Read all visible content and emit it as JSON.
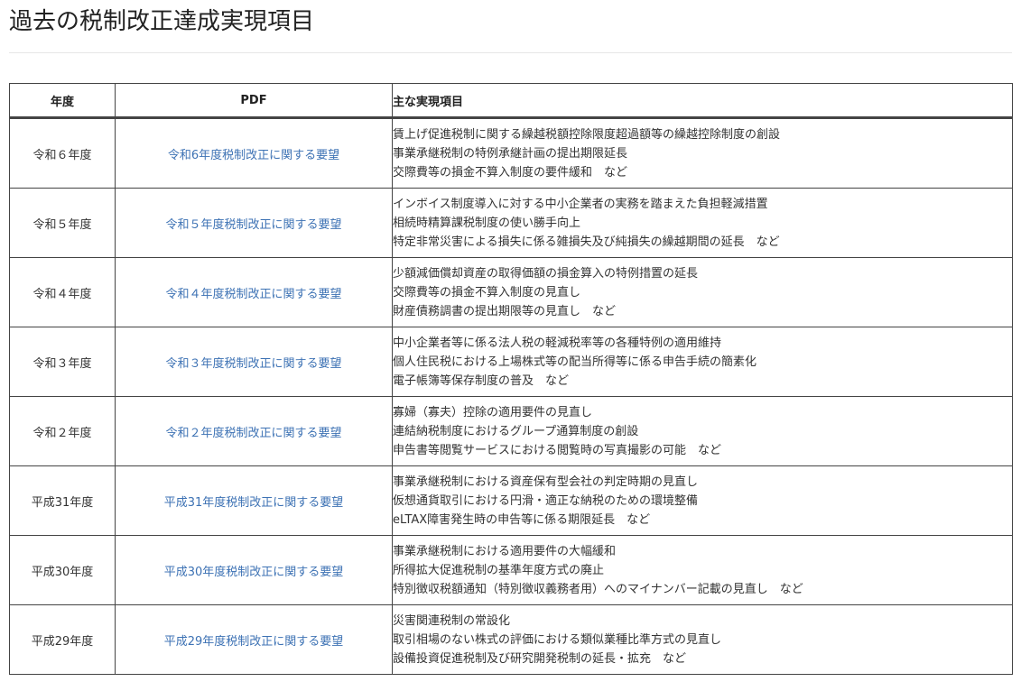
{
  "page": {
    "title": "過去の税制改正達成実現項目"
  },
  "table": {
    "headers": {
      "year": "年度",
      "pdf": "PDF",
      "items": "主な実現項目"
    },
    "rows": [
      {
        "year": "令和６年度",
        "pdf_link": "令和6年度税制改正に関する要望",
        "items": [
          "賃上げ促進税制に関する繰越税額控除限度超過額等の繰越控除制度の創設",
          "事業承継税制の特例承継計画の提出期限延長",
          "交際費等の損金不算入制度の要件緩和　など"
        ]
      },
      {
        "year": "令和５年度",
        "pdf_link": "令和５年度税制改正に関する要望",
        "items": [
          "インボイス制度導入に対する中小企業者の実務を踏まえた負担軽減措置",
          "相続時精算課税制度の使い勝手向上",
          "特定非常災害による損失に係る雑損失及び純損失の繰越期間の延長　など"
        ]
      },
      {
        "year": "令和４年度",
        "pdf_link": "令和４年度税制改正に関する要望",
        "items": [
          "少額減価償却資産の取得価額の損金算入の特例措置の延長",
          "交際費等の損金不算入制度の見直し",
          "財産債務調書の提出期限等の見直し　など"
        ]
      },
      {
        "year": "令和３年度",
        "pdf_link": "令和３年度税制改正に関する要望",
        "items": [
          "中小企業者等に係る法人税の軽減税率等の各種特例の適用維持",
          "個人住民税における上場株式等の配当所得等に係る申告手続の簡素化",
          "電子帳簿等保存制度の普及　など"
        ]
      },
      {
        "year": "令和２年度",
        "pdf_link": "令和２年度税制改正に関する要望",
        "items": [
          "寡婦（寡夫）控除の適用要件の見直し",
          "連結納税制度におけるグループ通算制度の創設",
          "申告書等閲覧サービスにおける閲覧時の写真撮影の可能　など"
        ]
      },
      {
        "year": "平成31年度",
        "pdf_link": "平成31年度税制改正に関する要望",
        "items": [
          "事業承継税制における資産保有型会社の判定時期の見直し",
          "仮想通貨取引における円滑・適正な納税のための環境整備",
          "eLTAX障害発生時の申告等に係る期限延長　など"
        ]
      },
      {
        "year": "平成30年度",
        "pdf_link": "平成30年度税制改正に関する要望",
        "items": [
          "事業承継税制における適用要件の大幅緩和",
          "所得拡大促進税制の基準年度方式の廃止",
          "特別徴収税額通知（特別徴収義務者用）へのマイナンバー記載の見直し　など"
        ]
      },
      {
        "year": "平成29年度",
        "pdf_link": "平成29年度税制改正に関する要望",
        "items": [
          "災害関連税制の常設化",
          "取引相場のない株式の評価における類似業種比準方式の見直し",
          "設備投資促進税制及び研究開発税制の延長・拡充　など"
        ]
      }
    ]
  }
}
